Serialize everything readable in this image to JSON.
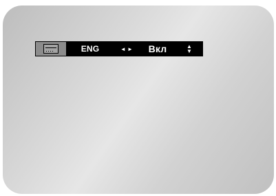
{
  "osd": {
    "language": "ENG",
    "state": "Вкл",
    "icons": {
      "subtitle": "subtitle-icon",
      "left_right": "left-right-arrows-icon",
      "up_down": "up-down-arrows-icon"
    },
    "glyphs": {
      "left": "◄",
      "right": "►",
      "up": "▲",
      "down": "▼"
    }
  },
  "colors": {
    "bar": "#000000",
    "icon_cell": "#8c8c8c",
    "text": "#ffffff"
  }
}
